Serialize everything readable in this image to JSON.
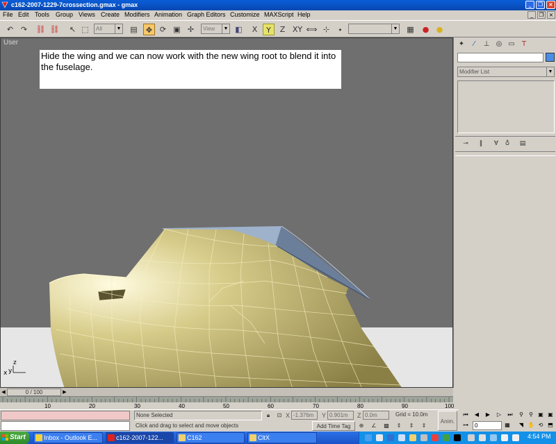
{
  "window": {
    "title": "c162-2007-1229-7crossection.gmax - gmax",
    "minimize_icon": "minimize-icon",
    "maximize_icon": "restore-icon",
    "close_icon": "close-icon"
  },
  "menu": {
    "items": [
      "File",
      "Edit",
      "Tools",
      "Group",
      "Views",
      "Create",
      "Modifiers",
      "Animation",
      "Graph Editors",
      "Customize",
      "MAXScript",
      "Help"
    ]
  },
  "toolbar": {
    "selection_filter": "All",
    "reference_coord": "View",
    "axis_x": "X",
    "axis_y": "Y",
    "axis_z": "Z",
    "axis_xy": "XY",
    "named_selection": ""
  },
  "viewport": {
    "label": "User",
    "annotation": "Hide the wing and we can now work with the new wing root to blend it into the fuselage.",
    "axis_z": "z",
    "axis_x": "x",
    "axis_y": "y",
    "colors": {
      "background": "#6f6f6f",
      "ground": "#e6e6e6",
      "mesh": "#c8bc7c",
      "wire": "#f5eec0",
      "wing_root": "#6b7f9a"
    }
  },
  "command_panel": {
    "object_name": "",
    "object_color": "#4a8ee8",
    "modifier_list": "Modifier List"
  },
  "time_slider": {
    "frame_display": "0 / 100",
    "current_frame": 0,
    "total_frames": 100
  },
  "trackbar": {
    "tick_labels": [
      "10",
      "20",
      "30",
      "40",
      "50",
      "60",
      "70",
      "80",
      "90",
      "100"
    ]
  },
  "status": {
    "selection": "None Selected",
    "prompt": "Click and drag to select and move objects",
    "x_label": "X",
    "x_value": "-1.376m",
    "y_label": "Y",
    "y_value": "0.901m",
    "z_label": "Z",
    "z_value": "0.0m",
    "grid": "Grid = 10.0m",
    "add_time_tag": "Add Time Tag",
    "anim": "Anim."
  },
  "playback": {
    "frame": "0"
  },
  "taskbar": {
    "start": "Start",
    "tasks": [
      "Inbox - Outlook E...",
      "c162-2007-122...",
      "C162",
      "CltX"
    ],
    "clock": "4:54 PM"
  }
}
